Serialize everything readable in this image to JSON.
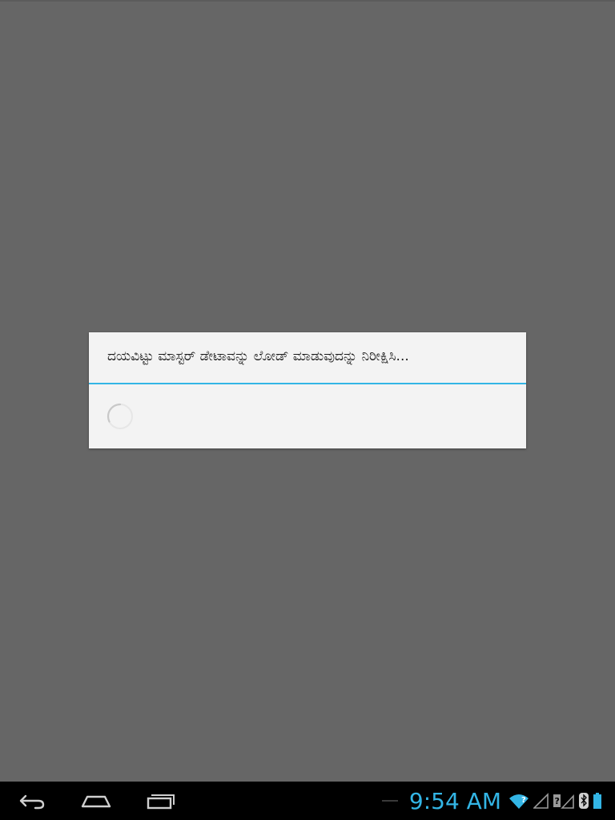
{
  "dialog": {
    "message": "ದಯವಿಟ್ಟು ಮಾಸ್ಟರ್ ಡೇಟಾವನ್ನು ಲೋಡ್ ಮಾಡುವುದನ್ನು ನಿರೀಕ್ಷಿಸಿ..."
  },
  "status_bar": {
    "time": "9:54 AM",
    "accent_color": "#33b5e5"
  },
  "nav_bar": {
    "buttons": [
      "back-icon",
      "home-icon",
      "recent-apps-icon"
    ]
  }
}
